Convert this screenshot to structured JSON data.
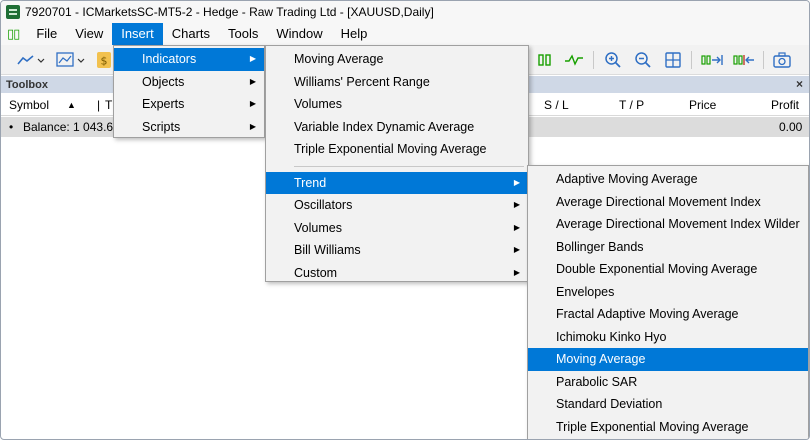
{
  "window": {
    "title": "7920701 - ICMarketsSC-MT5-2 - Hedge - Raw Trading Ltd - [XAUUSD,Daily]"
  },
  "menubar": {
    "items": [
      {
        "label": "File"
      },
      {
        "label": "View"
      },
      {
        "label": "Insert"
      },
      {
        "label": "Charts"
      },
      {
        "label": "Tools"
      },
      {
        "label": "Window"
      },
      {
        "label": "Help"
      }
    ]
  },
  "toolbox": {
    "title": "Toolbox",
    "close": "×",
    "columns": {
      "symbol": "Symbol",
      "t": "T",
      "sl": "S / L",
      "tp": "T / P",
      "price": "Price",
      "profit": "Profit"
    },
    "balance": {
      "label": "Balance: 1 043.6",
      "profit": "0.00"
    }
  },
  "insert_menu": {
    "items": [
      {
        "label": "Indicators"
      },
      {
        "label": "Objects"
      },
      {
        "label": "Experts"
      },
      {
        "label": "Scripts"
      }
    ]
  },
  "indicators_menu": {
    "items": [
      "Moving Average",
      "Williams' Percent Range",
      "Volumes",
      "Variable Index Dynamic Average",
      "Triple Exponential Moving Average"
    ],
    "groups": [
      "Trend",
      "Oscillators",
      "Volumes",
      "Bill Williams",
      "Custom"
    ]
  },
  "trend_menu": {
    "items": [
      "Adaptive Moving Average",
      "Average Directional Movement Index",
      "Average Directional Movement Index Wilder",
      "Bollinger Bands",
      "Double Exponential Moving Average",
      "Envelopes",
      "Fractal Adaptive Moving Average",
      "Ichimoku Kinko Hyo",
      "Moving Average",
      "Parabolic SAR",
      "Standard Deviation",
      "Triple Exponential Moving Average"
    ],
    "selected_index": 8
  },
  "colors": {
    "highlight": "#0078d7",
    "menu_bg": "#f2f2f2",
    "toolbox_header": "#cfd8e6",
    "balance_row": "#dcdcdc"
  }
}
